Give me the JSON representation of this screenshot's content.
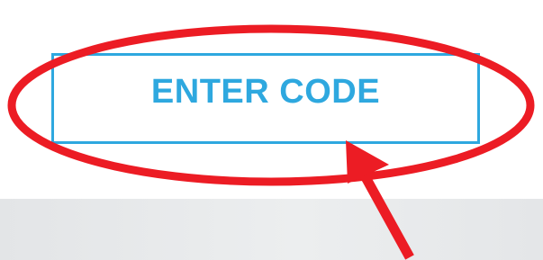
{
  "button": {
    "label": "ENTER CODE",
    "color": "#2ea8df"
  },
  "annotation": {
    "color": "#ec1c24",
    "shapes": [
      "ellipse-highlight",
      "arrow-pointer"
    ]
  },
  "background": {
    "top_color": "#ffffff",
    "bottom_bar_color": "#e8eaec"
  }
}
